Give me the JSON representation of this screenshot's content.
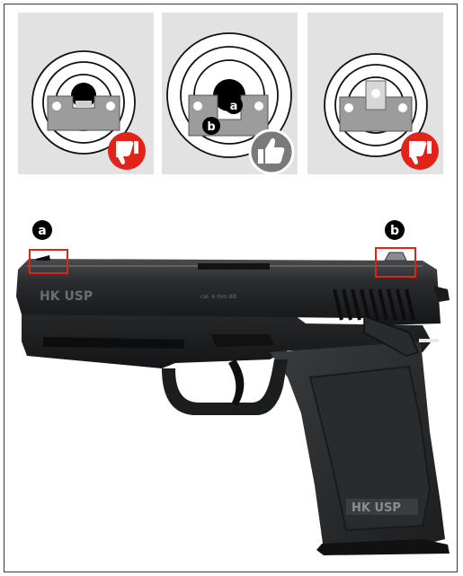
{
  "panels": [
    {
      "id": "too-low",
      "verdict": "incorrect",
      "verdict_icon": "thumbs-down-icon",
      "verdict_color": "#e2231a"
    },
    {
      "id": "correct",
      "verdict": "correct",
      "verdict_icon": "thumbs-up-icon",
      "verdict_color": "#7a7a7a",
      "labels": [
        "a",
        "b"
      ]
    },
    {
      "id": "too-high",
      "verdict": "incorrect",
      "verdict_icon": "thumbs-down-icon",
      "verdict_color": "#e2231a"
    }
  ],
  "markers": {
    "front_sight": "a",
    "rear_sight": "b",
    "highlight_color": "#e2231a"
  },
  "pistol": {
    "slide_marking_left": "HK USP",
    "slide_marking_right": "cal. 6 mm BB",
    "grip_marking": "HK USP"
  }
}
